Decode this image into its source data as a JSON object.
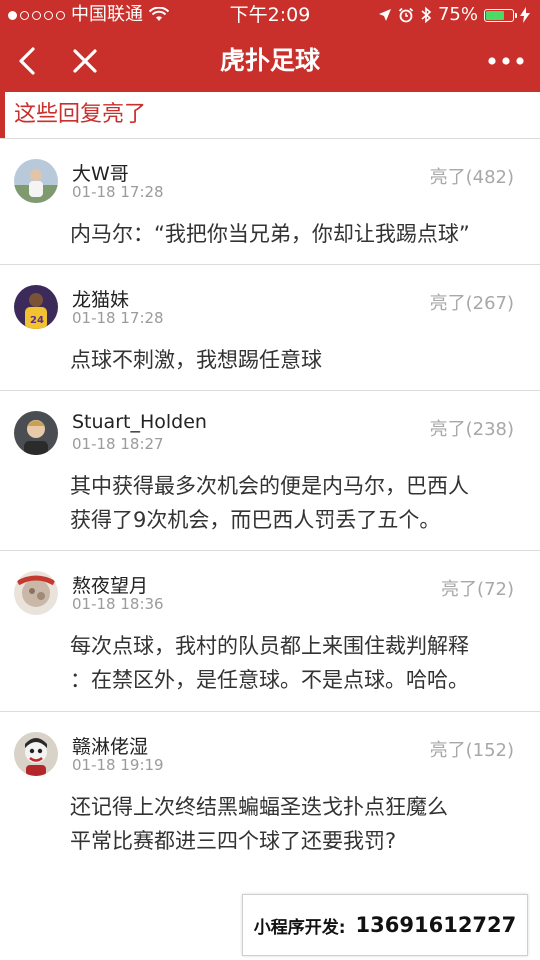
{
  "status_bar": {
    "carrier": "中国联通",
    "time": "下午2:09",
    "battery": "75%",
    "battery_level": 0.75
  },
  "nav": {
    "title": "虎扑足球",
    "icons": [
      "back-icon",
      "close-icon",
      "more-icon"
    ]
  },
  "section": {
    "title": "这些回复亮了"
  },
  "comments": [
    {
      "user": "大W哥",
      "time": "01-18 17:28",
      "likes": "亮了(482)",
      "lines": [
        "内马尔：“我把你当兄弟，你却让我踢点球”"
      ]
    },
    {
      "user": "龙猫妹",
      "time": "01-18 17:28",
      "likes": "亮了(267)",
      "lines": [
        "点球不刺激，我想踢任意球"
      ]
    },
    {
      "user": "Stuart_Holden",
      "time": "01-18 18:27",
      "likes": "亮了(238)",
      "lines": [
        "其中获得最多次机会的便是内马尔，巴西人",
        "获得了9次机会，而巴西人罚丢了五个。"
      ]
    },
    {
      "user": "熬夜望月",
      "time": "01-18 18:36",
      "likes": "亮了(72)",
      "lines": [
        "每次点球，我村的队员都上来围住裁判解释",
        "：在禁区外，是任意球。不是点球。哈哈。"
      ]
    },
    {
      "user": "赣淋佬湿",
      "time": "01-18 19:19",
      "likes": "亮了(152)",
      "lines": [
        "还记得上次终结黑蝙蝠圣迭戈扑点狂魔么",
        "平常比赛都进三四个球了还要我罚?"
      ]
    }
  ],
  "promo": {
    "label": "小程序开发:",
    "phone": "13691612727"
  },
  "colors": {
    "brand_red": "#c9302c",
    "battery_green": "#4cd964"
  }
}
